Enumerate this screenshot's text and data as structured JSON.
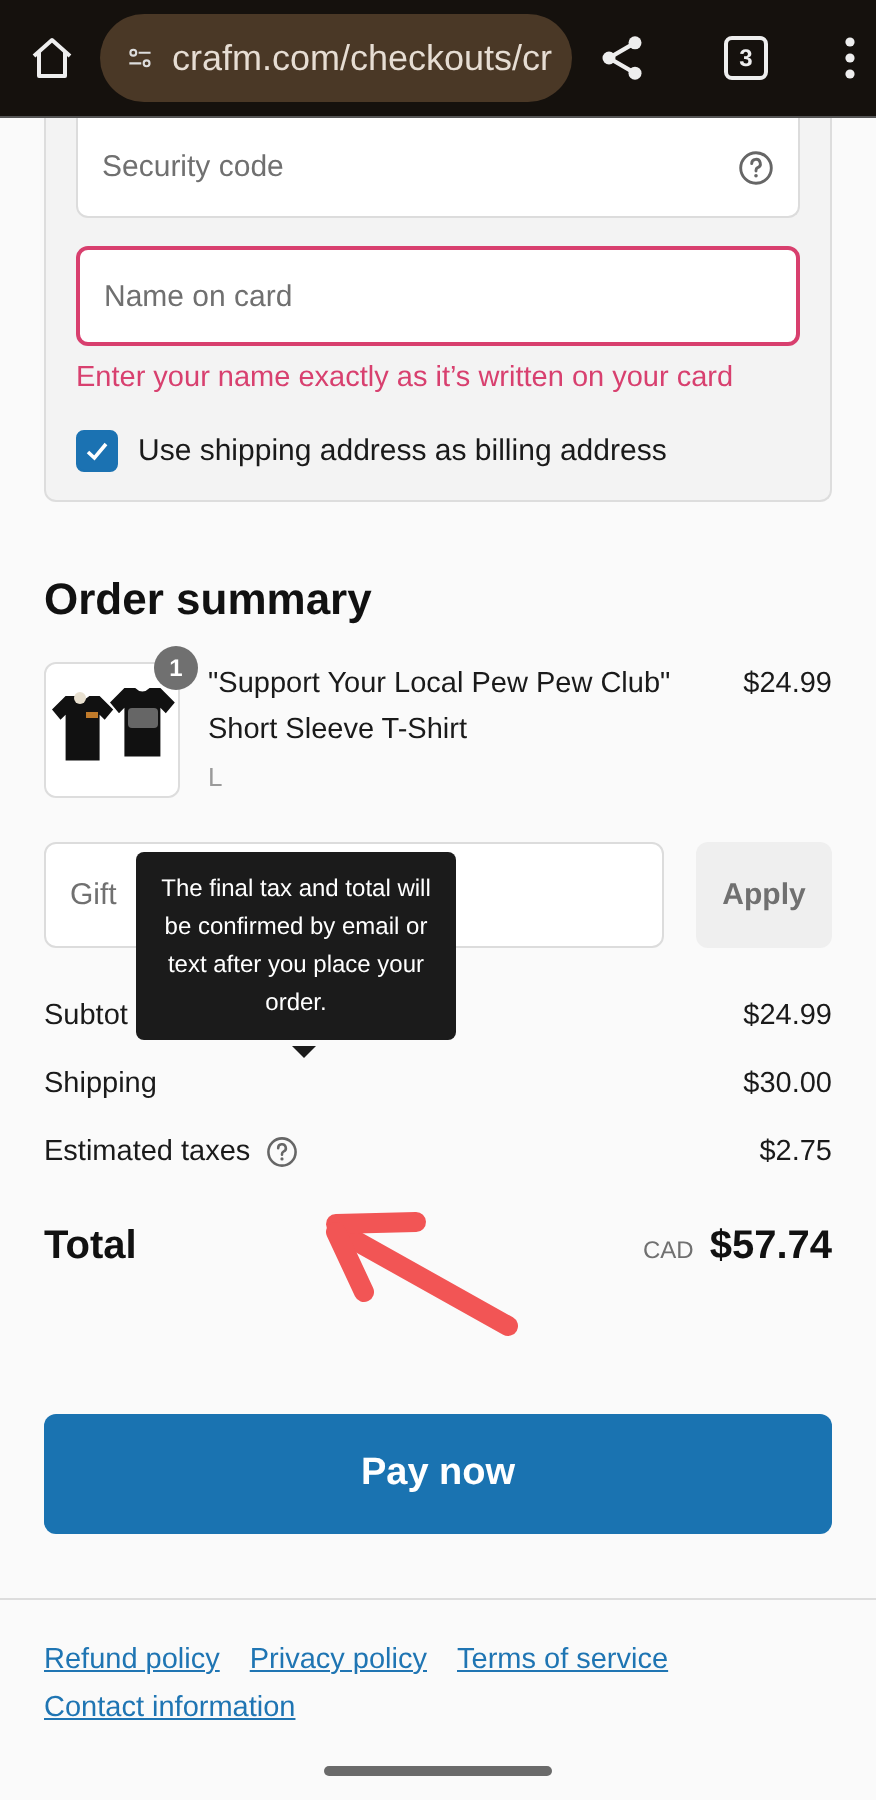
{
  "browser": {
    "url": "crafm.com/checkouts/cr",
    "tab_count": "3"
  },
  "payment": {
    "fields": [
      {
        "placeholder": "Security code",
        "help": true,
        "invalid": false
      },
      {
        "placeholder": "Name on card",
        "help": false,
        "invalid": true,
        "error": "Enter your name exactly as it’s written on your card"
      }
    ],
    "billing_checkbox": {
      "label": "Use shipping address as billing address",
      "checked": true
    }
  },
  "order_summary": {
    "title": "Order summary",
    "items": [
      {
        "quantity": "1",
        "name": "\"Support Your Local Pew Pew Club\" Short Sleeve T-Shirt",
        "variant": "L",
        "price": "$24.99"
      }
    ],
    "gift_card": {
      "placeholder": "Gift",
      "button": "Apply"
    },
    "lines": [
      {
        "label": "Subtot",
        "value": "$24.99"
      },
      {
        "label": "Shipping",
        "value": "$30.00"
      },
      {
        "label": "Estimated taxes",
        "value": "$2.75",
        "help": true
      }
    ],
    "tooltip": "The final tax and total will be confirmed by email or text after you place your order.",
    "total": {
      "label": "Total",
      "currency": "CAD",
      "value": "$57.74"
    }
  },
  "pay_button": "Pay now",
  "footer_links": [
    "Refund policy",
    "Privacy policy",
    "Terms of service",
    "Contact information"
  ]
}
